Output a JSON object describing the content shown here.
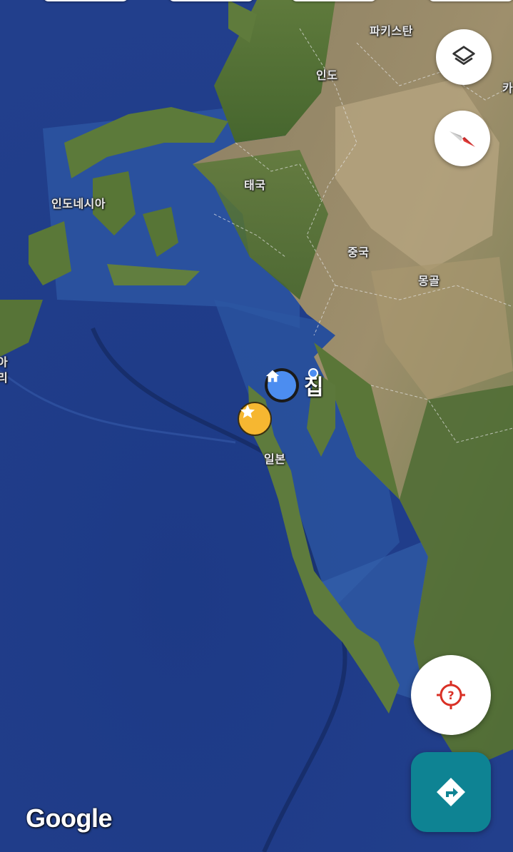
{
  "map": {
    "type": "satellite",
    "labels": {
      "pakistan": "파키스탄",
      "india": "인도",
      "thailand": "태국",
      "indonesia": "인도네시아",
      "china": "중국",
      "mongolia": "몽골",
      "japan": "일본",
      "partial_ka": "카",
      "partial_left_top": "아",
      "partial_left_bottom": "리"
    }
  },
  "pins": {
    "home": {
      "label": "집",
      "icon": "home-icon",
      "color": "#4c8df0"
    },
    "saved": {
      "icon": "star-icon",
      "color": "#f6b731"
    }
  },
  "controls": {
    "layers": {
      "icon": "layers-icon"
    },
    "compass": {
      "icon": "compass-icon",
      "needle_color": "#e53935"
    },
    "my_location": {
      "icon": "location-unknown-icon",
      "color": "#d93025"
    },
    "directions": {
      "icon": "directions-icon",
      "color": "#0e8393"
    }
  },
  "attribution": {
    "logo": "Google"
  }
}
